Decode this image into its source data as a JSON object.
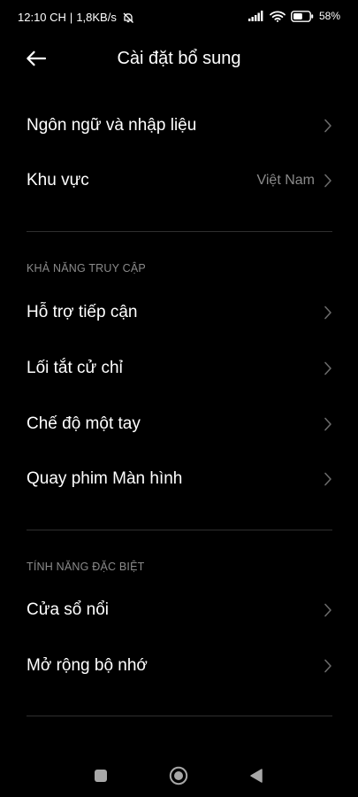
{
  "status_bar": {
    "time": "12:10 CH",
    "separator": "|",
    "speed": "1,8KB/s",
    "battery_percent": "58%",
    "battery_level": 0.58,
    "icons": [
      "mute-bell-icon",
      "signal-icon",
      "wifi-icon",
      "battery-icon"
    ]
  },
  "header": {
    "title": "Cài đặt bổ sung",
    "back_icon": "arrow-left-icon"
  },
  "general": {
    "items": [
      {
        "label": "Ngôn ngữ và nhập liệu",
        "value": ""
      },
      {
        "label": "Khu vực",
        "value": "Việt Nam"
      }
    ]
  },
  "accessibility": {
    "header": "KHẢ NĂNG TRUY CẬP",
    "items": [
      {
        "label": "Hỗ trợ tiếp cận"
      },
      {
        "label": "Lối tắt cử chỉ"
      },
      {
        "label": "Chế độ một tay"
      },
      {
        "label": "Quay phim Màn hình"
      }
    ]
  },
  "special": {
    "header": "TÍNH NĂNG ĐẶC BIỆT",
    "items": [
      {
        "label": "Cửa sổ nổi"
      },
      {
        "label": "Mở rộng bộ nhớ"
      }
    ]
  },
  "nav_bar": {
    "icons": [
      "recents-square-icon",
      "home-circle-icon",
      "back-triangle-icon"
    ]
  },
  "colors": {
    "background": "#000000",
    "text_primary": "#ffffff",
    "text_secondary": "#8a8a8a",
    "chevron": "#6a6a6a",
    "divider": "#2f2f2f"
  }
}
